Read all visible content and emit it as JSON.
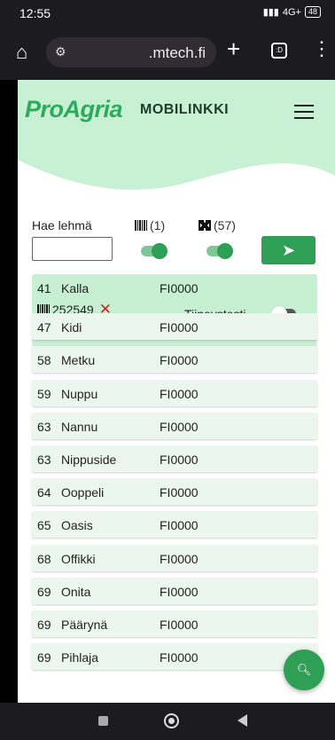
{
  "status": {
    "time": "12:55",
    "network": "4G+",
    "battery": "48"
  },
  "browser": {
    "url": ".mtech.fi",
    "tabs_label": ":D"
  },
  "header": {
    "logo": "ProAgria",
    "title": "MOBILINKKI"
  },
  "search": {
    "label": "Hae lehmä",
    "value": "",
    "count_barcode": "(1)",
    "count_qr": "(57)"
  },
  "selected": {
    "id": "41",
    "name": "Kalla",
    "code": "FI0000",
    "tag": "252549",
    "toggle_label": "Tiineystesti"
  },
  "rows": [
    {
      "id": "47",
      "name": "Kidi",
      "code": "FI0000"
    },
    {
      "id": "58",
      "name": "Metku",
      "code": "FI0000"
    },
    {
      "id": "59",
      "name": "Nuppu",
      "code": "FI0000"
    },
    {
      "id": "63",
      "name": "Nannu",
      "code": "FI0000"
    },
    {
      "id": "63",
      "name": "Nippuside",
      "code": "FI0000"
    },
    {
      "id": "64",
      "name": "Ooppeli",
      "code": "FI0000"
    },
    {
      "id": "65",
      "name": "Oasis",
      "code": "FI0000"
    },
    {
      "id": "68",
      "name": "Offikki",
      "code": "FI0000"
    },
    {
      "id": "69",
      "name": "Onita",
      "code": "FI0000"
    },
    {
      "id": "69",
      "name": "Päärynä",
      "code": "FI0000"
    },
    {
      "id": "69",
      "name": "Pihlaja",
      "code": "FI0000"
    }
  ],
  "colors": {
    "accent": "#2e9f55",
    "hero": "#c8f1d4",
    "row_bg": "#ebf7ee",
    "selected_bg": "#c7f0d3"
  }
}
